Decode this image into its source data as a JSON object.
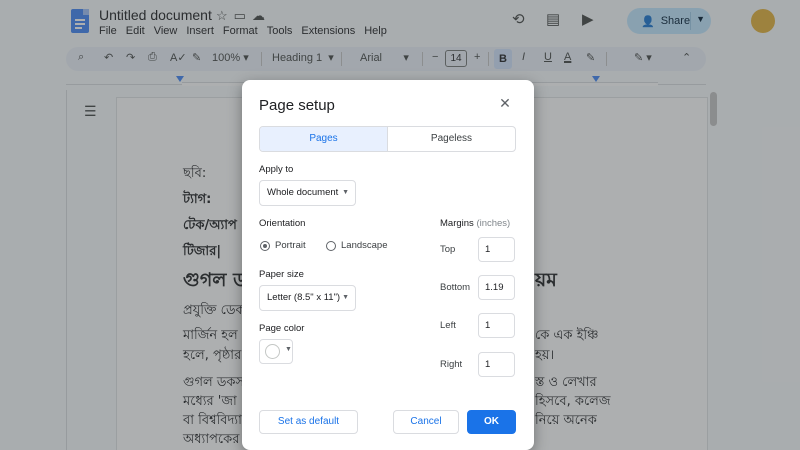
{
  "app": {
    "doc_title": "Untitled document",
    "menu": [
      "File",
      "Edit",
      "View",
      "Insert",
      "Format",
      "Tools",
      "Extensions",
      "Help"
    ],
    "share_label": "Share"
  },
  "toolbar": {
    "zoom": "100%",
    "style": "Heading 1",
    "font": "Arial",
    "font_size": "14",
    "bold": "B",
    "underline_color": "A"
  },
  "document": {
    "lines": [
      "ছবি:",
      "ট্যাগ:",
      "টেক/অ্যাপ",
      "টিজার|",
      "গুগল ড",
      "য়ম",
      "প্রযুক্তি ডেক",
      "মার্জিন হল",
      "কে এক ইঞ্চি",
      "হলে, পৃষ্ঠার",
      "হয়।",
      "গুগল ডকস",
      "স্ত ও লেখার",
      "মধ্যের 'জা",
      "হিসবে, কলেজ",
      "বা বিশ্ববিদ্যা",
      "নিয়ে অনেক",
      "অধ্যাপকের"
    ]
  },
  "dialog": {
    "title": "Page setup",
    "tabs": {
      "pages": "Pages",
      "pageless": "Pageless"
    },
    "apply_to_label": "Apply to",
    "apply_to_value": "Whole document",
    "orientation_label": "Orientation",
    "portrait": "Portrait",
    "landscape": "Landscape",
    "orientation_selected": "Portrait",
    "paper_size_label": "Paper size",
    "paper_size_value": "Letter (8.5\" x 11\")",
    "page_color_label": "Page color",
    "page_color_value": "#ffffff",
    "margins_label": "Margins",
    "margins_unit": "(inches)",
    "margins": [
      {
        "label": "Top",
        "value": "1"
      },
      {
        "label": "Bottom",
        "value": "1.19"
      },
      {
        "label": "Left",
        "value": "1"
      },
      {
        "label": "Right",
        "value": "1"
      }
    ],
    "set_default": "Set as default",
    "cancel": "Cancel",
    "ok": "OK"
  },
  "colors": {
    "accent": "#1a73e8",
    "share_bg": "#c2e7ff",
    "docs_blue": "#4285f4",
    "overlay": "rgba(60,64,67,0.42)"
  }
}
